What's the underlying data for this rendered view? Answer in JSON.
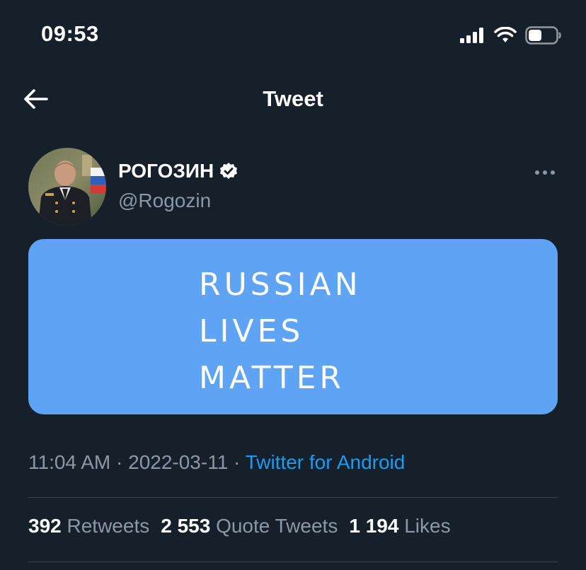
{
  "status_bar": {
    "time": "09:53",
    "icons": [
      "signal-icon",
      "wifi-icon",
      "battery-icon"
    ]
  },
  "nav": {
    "title": "Tweet",
    "back_icon": "back-arrow-icon"
  },
  "tweet": {
    "author_name": "РОГОЗИН",
    "author_handle": "@Rogozin",
    "verified": true,
    "media_lines": [
      "RUSSIAN",
      "LIVES",
      "MATTER"
    ],
    "time": "11:04 AM",
    "date": "2022-03-11",
    "source": "Twitter for Android",
    "separator": " · "
  },
  "stats": {
    "retweets_count": "392",
    "retweets_label": "Retweets",
    "quotes_count": "2 553",
    "quotes_label": "Quote Tweets",
    "likes_count": "1 194",
    "likes_label": "Likes"
  },
  "colors": {
    "background": "#15202b",
    "media_background": "#5fa3f5",
    "secondary_text": "#8b98a5",
    "link": "#1d9bf0",
    "divider": "#38444d"
  }
}
